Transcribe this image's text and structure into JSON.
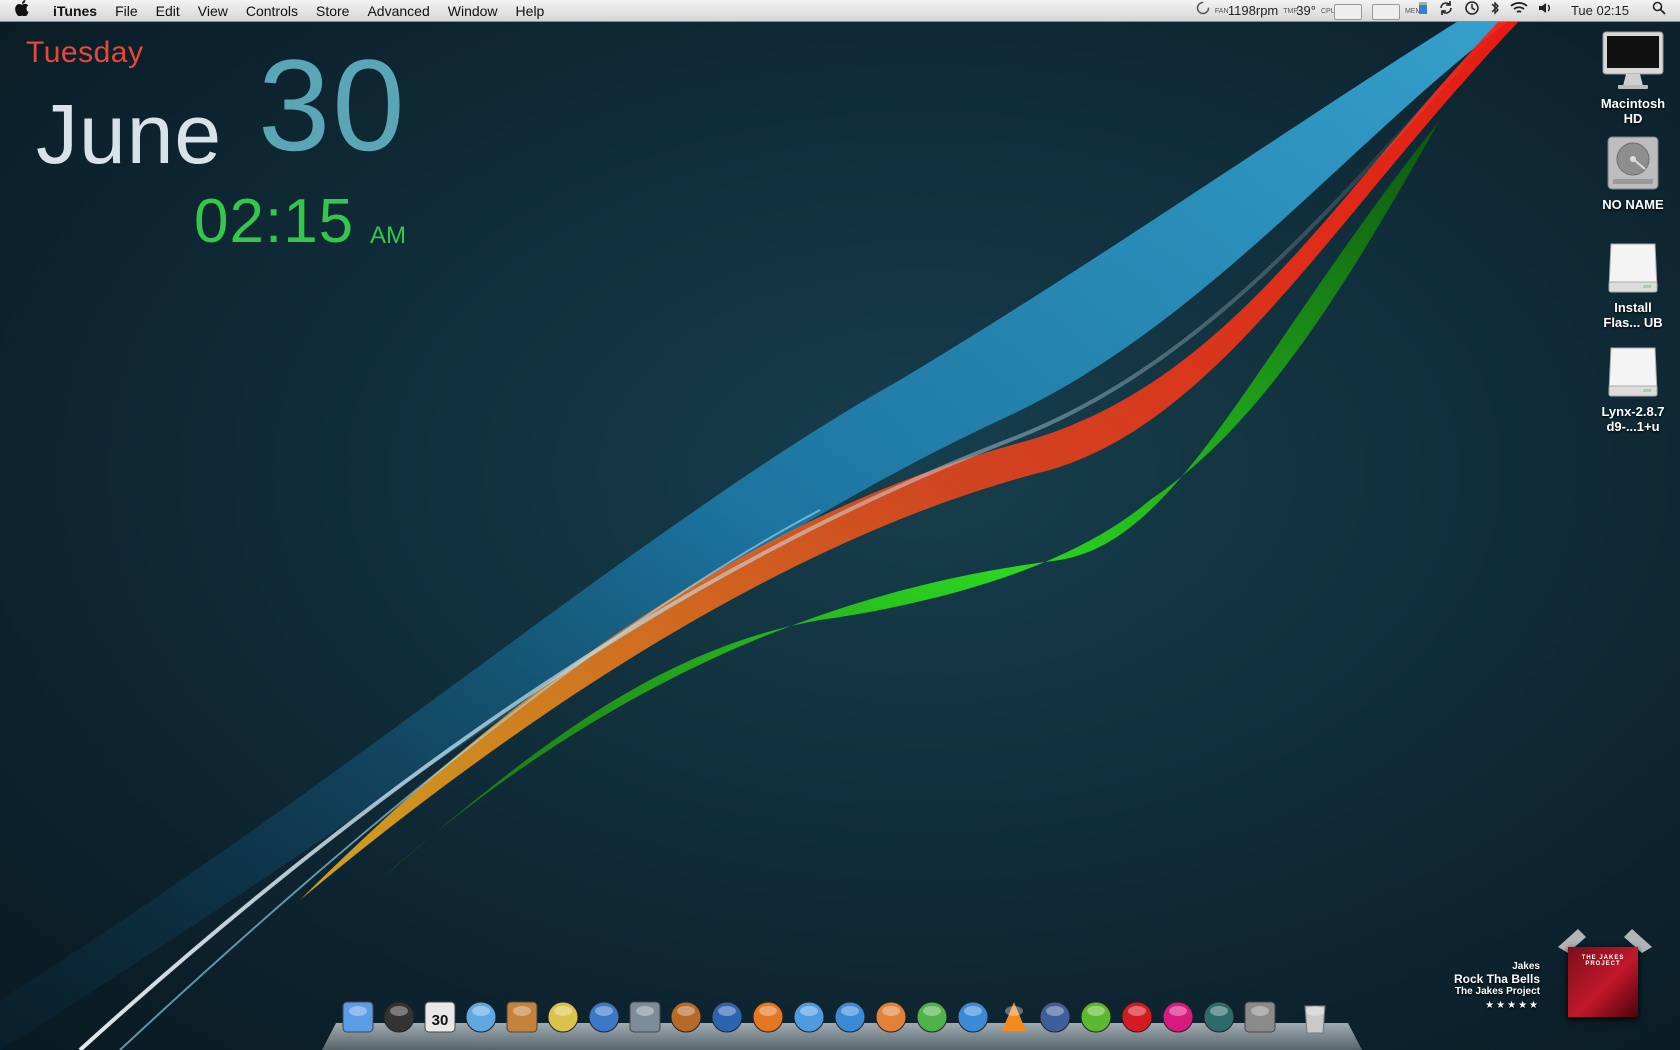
{
  "menubar": {
    "apple_glyph": "",
    "app_name": "iTunes",
    "menus": [
      "File",
      "Edit",
      "View",
      "Controls",
      "Store",
      "Advanced",
      "Window",
      "Help"
    ],
    "status": {
      "fan_tiny": "FAN",
      "fan_speed": "1198rpm",
      "temp_tiny": "TMP",
      "temperature": "39°",
      "cpu_tiny": "CPU",
      "mem_tiny": "MEM",
      "clock": "Tue 02:15"
    }
  },
  "clock_widget": {
    "weekday": "Tuesday",
    "month": "June",
    "day": "30",
    "time": "02:15",
    "ampm": "AM"
  },
  "desktop_icons": [
    {
      "label_line1": "Macintosh",
      "label_line2": "HD",
      "icon": "imac-icon"
    },
    {
      "label_line1": "NO NAME",
      "label_line2": "",
      "icon": "hard-drive-icon"
    },
    {
      "label_line1": "Install",
      "label_line2": "Flas... UB",
      "icon": "disk-image-icon"
    },
    {
      "label_line1": "Lynx-2.8.7",
      "label_line2": "d9-...1+u",
      "icon": "disk-image-icon"
    }
  ],
  "now_playing": {
    "artist": "Jakes",
    "title": "Rock Tha Bells",
    "album": "The Jakes Project",
    "rating_stars": "★★★★★",
    "cover_text": "THE JAKES PROJECT"
  },
  "dock": {
    "apps": [
      {
        "name": "finder-icon",
        "color": "#5b9ce6"
      },
      {
        "name": "dashboard-icon",
        "color": "#333"
      },
      {
        "name": "ical-icon",
        "color": "#e8e8e8",
        "text": "30"
      },
      {
        "name": "itunes-icon",
        "color": "#5fa8e0"
      },
      {
        "name": "iphoto-icon",
        "color": "#c5823a"
      },
      {
        "name": "imovie-icon",
        "color": "#d9c34a"
      },
      {
        "name": "dvd-player-icon",
        "color": "#3b78c8"
      },
      {
        "name": "spaces-icon",
        "color": "#7c8c99"
      },
      {
        "name": "garageband-icon",
        "color": "#b56a2a"
      },
      {
        "name": "google-earth-icon",
        "color": "#2c64b0"
      },
      {
        "name": "firefox-icon",
        "color": "#e57722"
      },
      {
        "name": "safari-icon",
        "color": "#4f9be0"
      },
      {
        "name": "word-icon",
        "color": "#3a8ad8"
      },
      {
        "name": "powerpoint-icon",
        "color": "#e2813a"
      },
      {
        "name": "excel-icon",
        "color": "#4fb24a"
      },
      {
        "name": "messenger-icon",
        "color": "#3a8ad8"
      },
      {
        "name": "vlc-icon",
        "color": "#f28a1e"
      },
      {
        "name": "automator-icon",
        "color": "#3d5f9c"
      },
      {
        "name": "spotify-icon",
        "color": "#5cb82e"
      },
      {
        "name": "lastfm-icon",
        "color": "#d41b24"
      },
      {
        "name": "instacast-icon",
        "color": "#d61a7e"
      },
      {
        "name": "time-machine-icon",
        "color": "#2d6a6a"
      },
      {
        "name": "system-preferences-icon",
        "color": "#8a8a8a"
      },
      {
        "name": "trash-icon",
        "color": "#c8c8c8"
      }
    ]
  }
}
